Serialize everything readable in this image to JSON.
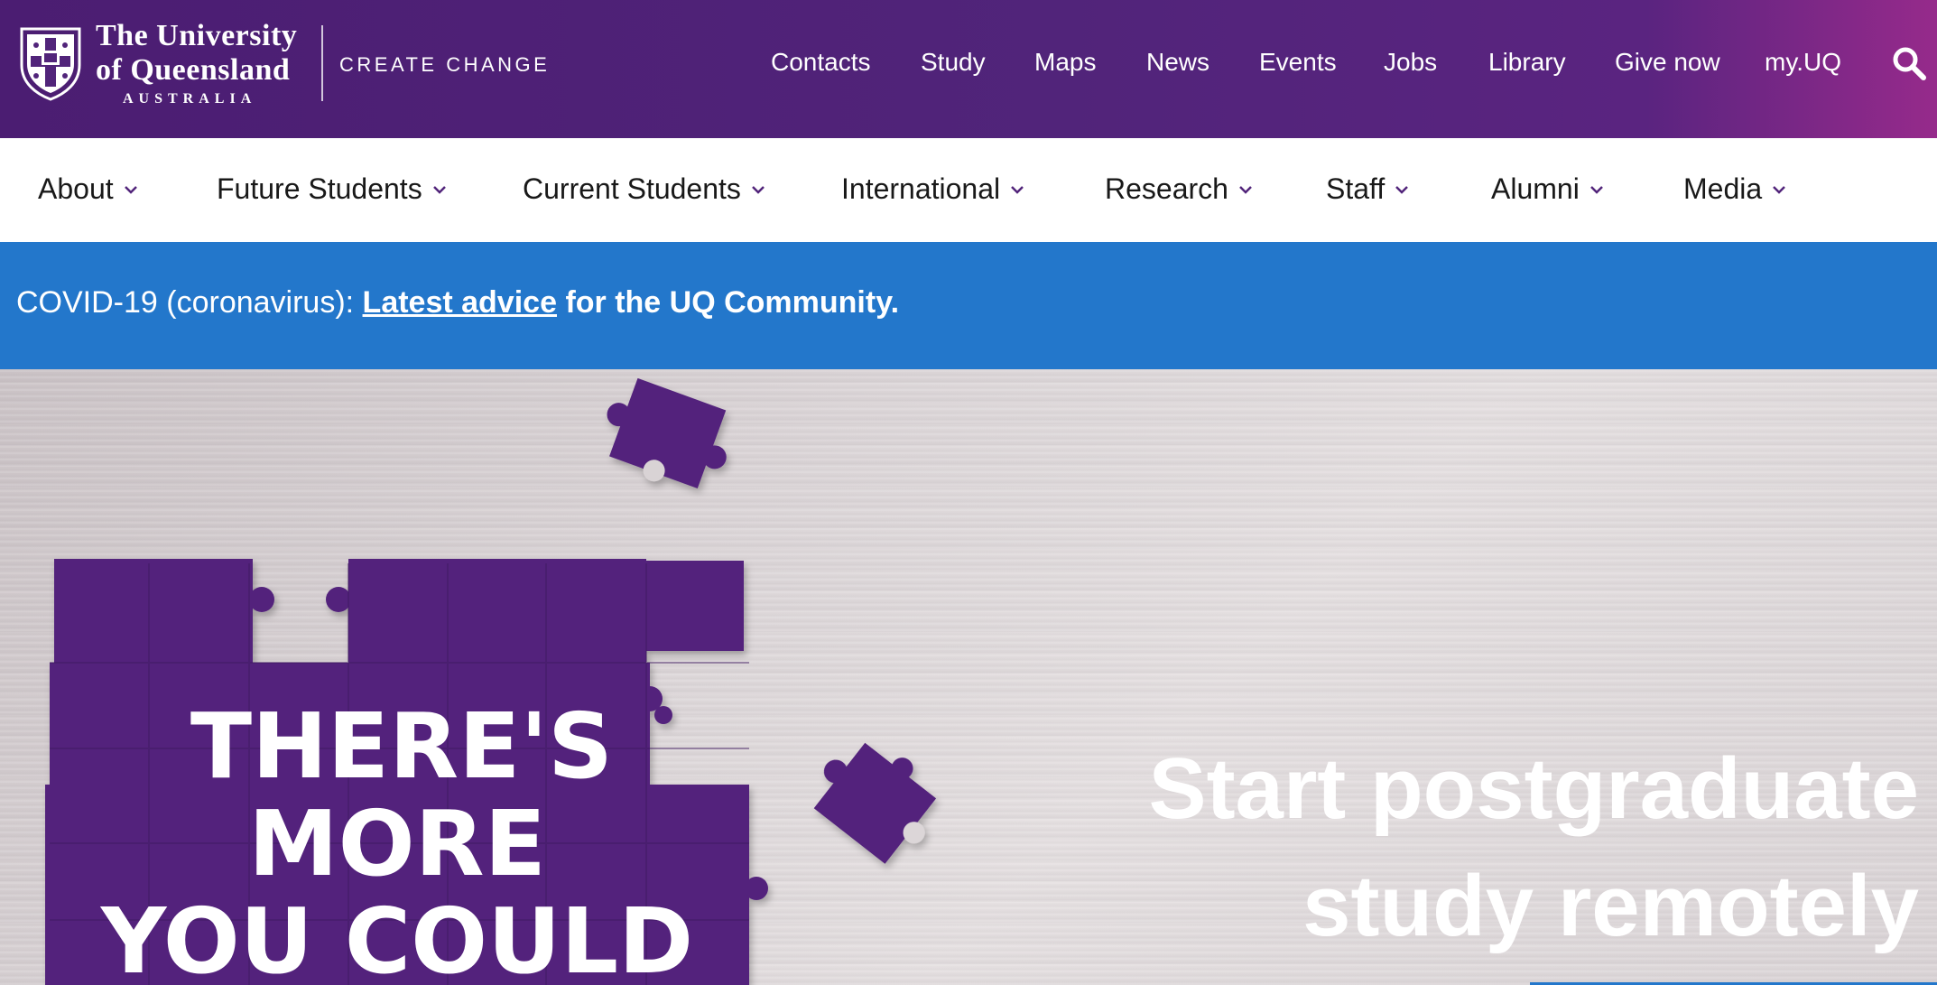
{
  "header": {
    "university": {
      "line1": "The University",
      "line2": "of Queensland",
      "country": "AUSTRALIA"
    },
    "tagline": "CREATE CHANGE",
    "utility_links": [
      "Contacts",
      "Study",
      "Maps",
      "News",
      "Events",
      "Jobs",
      "Library",
      "Give now",
      "my.UQ"
    ],
    "search_icon": "search-icon"
  },
  "main_nav": {
    "items": [
      "About",
      "Future Students",
      "Current Students",
      "International",
      "Research",
      "Staff",
      "Alumni",
      "Media"
    ],
    "chevron_icon": "chevron-down-icon"
  },
  "alert": {
    "prefix": "COVID-19 (coronavirus): ",
    "link_text": "Latest advice",
    "suffix": " for the UQ Community."
  },
  "hero": {
    "puzzle_text": [
      "THERE'S",
      "MORE",
      "YOU COULD"
    ],
    "heading_line1": "Start postgraduate",
    "heading_line2": "study remotely"
  },
  "colors": {
    "brand_purple": "#51247a",
    "header_accent": "#962a8b",
    "alert_blue": "#2377cb",
    "puzzle_purple": "#51247a"
  }
}
